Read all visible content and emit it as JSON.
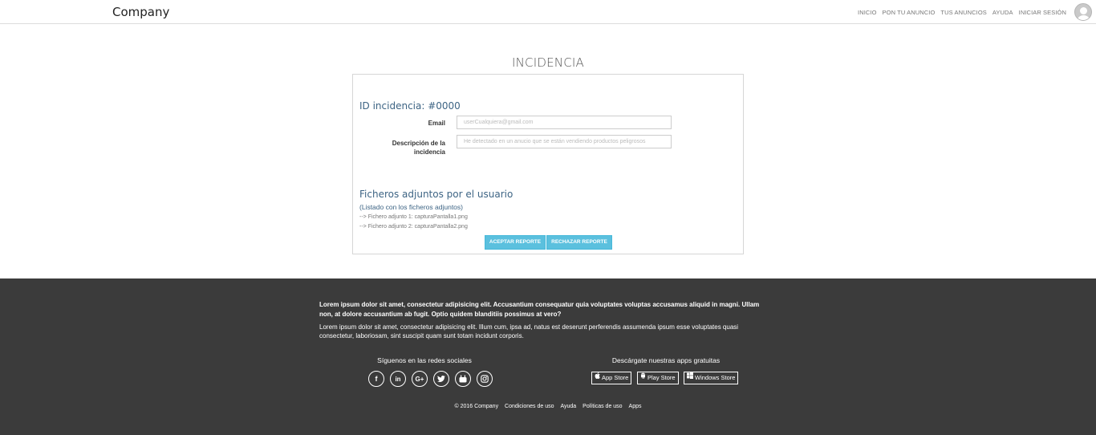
{
  "header": {
    "brand": "Company",
    "nav": [
      "INICIO",
      "PON TU ANUNCIO",
      "TUS ANUNCIOS",
      "AYUDA",
      "INICIAR SESIÓN"
    ]
  },
  "main": {
    "title": "INCIDENCIA",
    "incident_id": "ID incidencia: #0000",
    "email_label": "Email",
    "email_placeholder": "userCualquiera@gmail.com",
    "desc_label_line1": "Descripción de la",
    "desc_label_line2": "incidencia",
    "desc_placeholder": "He detectado en un anucio que se están vendiendo productos peligrosos",
    "files_title": "Ficheros adjuntos por el usuario",
    "files_subtitle": "(Listado con los ficheros adjuntos)",
    "files": [
      "--> Fichero adjunto 1: capturaPantalla1.png",
      "--> Fichero adjunto 2: capturaPantalla2.png"
    ],
    "accept_button": "ACEPTAR REPORTE",
    "reject_button": "RECHAZAR REPORTE"
  },
  "footer": {
    "bold_text": "Lorem ipsum dolor sit amet, consectetur adipisicing elit. Accusantium consequatur quia voluptates voluptas accusamus aliquid in magni. Ullam non, at dolore accusantium ab fugit. Optio quidem blanditiis possimus at vero?",
    "text": "Lorem ipsum dolor sit amet, consectetur adipisicing elit. Illum cum, ipsa ad, natus est deserunt perferendis assumenda ipsum esse voluptates quasi consectetur, laboriosam, sint suscipit quam sunt totam incidunt corporis.",
    "social_title": "Síguenos en las redes sociales",
    "social_icons": [
      "facebook-icon",
      "linkedin-icon",
      "google-plus-icon",
      "twitter-icon",
      "youtube-icon",
      "instagram-icon"
    ],
    "apps_title": "Descárgate nuestras apps gratuitas",
    "stores": [
      "App Store",
      "Play Store",
      "Windows Store"
    ],
    "bottom_links": [
      "© 2016 Company",
      "Condiciones de uso",
      "Ayuda",
      "Políticas de uso",
      "Apps"
    ]
  },
  "colors": {
    "accent_button": "#5bc0de",
    "heading_blue": "#3d6484",
    "footer_bg": "#3b3b3b"
  }
}
